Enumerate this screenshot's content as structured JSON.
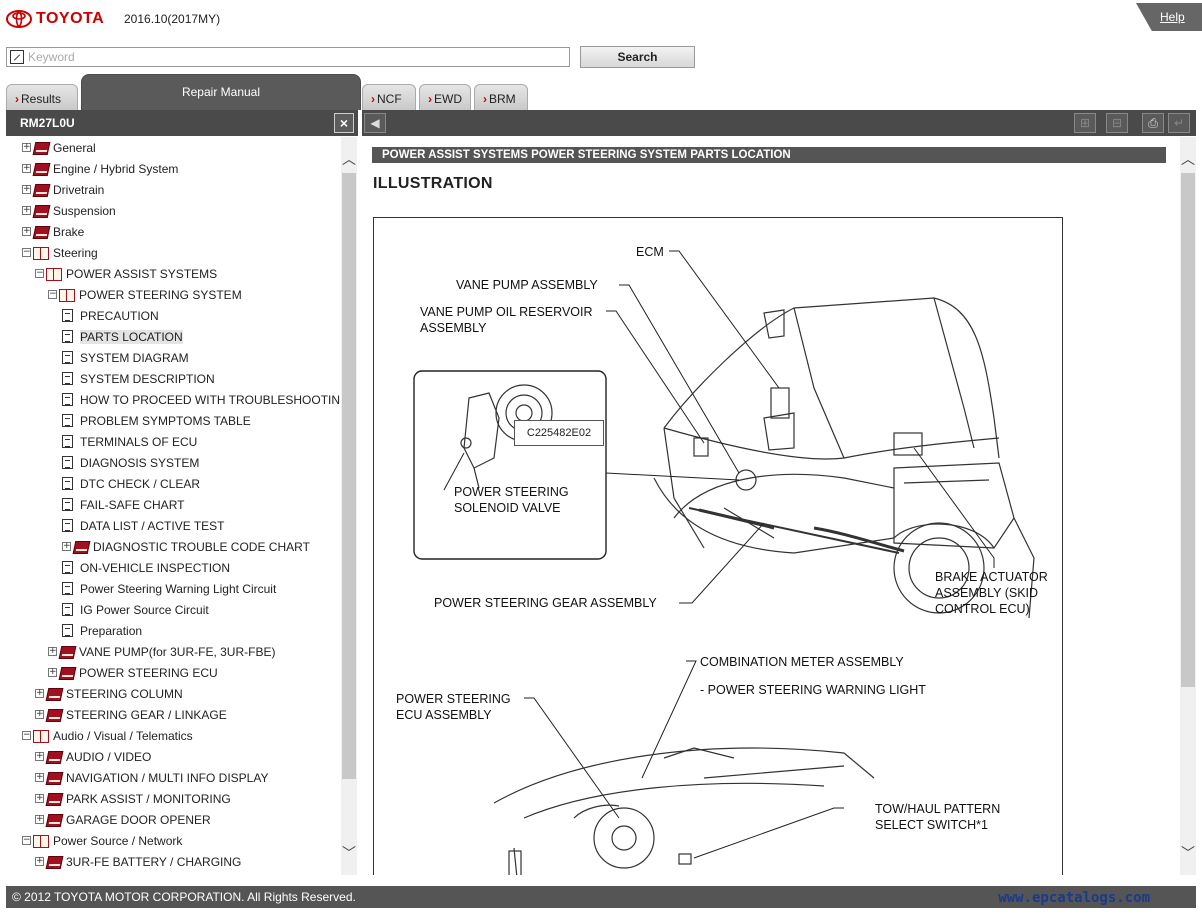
{
  "header": {
    "brand": "TOYOTA",
    "version": "2016.10(2017MY)",
    "help_label": "Help"
  },
  "search": {
    "placeholder": "Keyword",
    "button_label": "Search"
  },
  "tabs": [
    {
      "label": "Results",
      "active": false
    },
    {
      "label": "Repair Manual",
      "active": true
    },
    {
      "label": "NCF",
      "active": false
    },
    {
      "label": "EWD",
      "active": false
    },
    {
      "label": "BRM",
      "active": false
    }
  ],
  "left_panel": {
    "title": "RM27L0U",
    "close_label": "×",
    "tree": [
      {
        "label": "General",
        "level": 0,
        "type": "closed",
        "expand": "+"
      },
      {
        "label": "Engine / Hybrid System",
        "level": 0,
        "type": "closed",
        "expand": "+"
      },
      {
        "label": "Drivetrain",
        "level": 0,
        "type": "closed",
        "expand": "+"
      },
      {
        "label": "Suspension",
        "level": 0,
        "type": "closed",
        "expand": "+"
      },
      {
        "label": "Brake",
        "level": 0,
        "type": "closed",
        "expand": "+"
      },
      {
        "label": "Steering",
        "level": 0,
        "type": "open",
        "expand": "−"
      },
      {
        "label": "POWER ASSIST SYSTEMS",
        "level": 1,
        "type": "open",
        "expand": "−"
      },
      {
        "label": "POWER STEERING SYSTEM",
        "level": 2,
        "type": "open",
        "expand": "−"
      },
      {
        "label": "PRECAUTION",
        "level": 3,
        "type": "doc"
      },
      {
        "label": "PARTS LOCATION",
        "level": 3,
        "type": "doc",
        "selected": true
      },
      {
        "label": "SYSTEM DIAGRAM",
        "level": 3,
        "type": "doc"
      },
      {
        "label": "SYSTEM DESCRIPTION",
        "level": 3,
        "type": "doc"
      },
      {
        "label": "HOW TO PROCEED WITH TROUBLESHOOTING",
        "level": 3,
        "type": "doc"
      },
      {
        "label": "PROBLEM SYMPTOMS TABLE",
        "level": 3,
        "type": "doc"
      },
      {
        "label": "TERMINALS OF ECU",
        "level": 3,
        "type": "doc"
      },
      {
        "label": "DIAGNOSIS SYSTEM",
        "level": 3,
        "type": "doc"
      },
      {
        "label": "DTC CHECK / CLEAR",
        "level": 3,
        "type": "doc"
      },
      {
        "label": "FAIL-SAFE CHART",
        "level": 3,
        "type": "doc"
      },
      {
        "label": "DATA LIST / ACTIVE TEST",
        "level": 3,
        "type": "doc"
      },
      {
        "label": "DIAGNOSTIC TROUBLE CODE CHART",
        "level": 3,
        "type": "closed",
        "expand": "+"
      },
      {
        "label": "ON-VEHICLE INSPECTION",
        "level": 3,
        "type": "doc"
      },
      {
        "label": "Power Steering Warning Light Circuit",
        "level": 3,
        "type": "doc"
      },
      {
        "label": "IG Power Source Circuit",
        "level": 3,
        "type": "doc"
      },
      {
        "label": "Preparation",
        "level": 3,
        "type": "doc"
      },
      {
        "label": "VANE PUMP(for 3UR-FE, 3UR-FBE)",
        "level": 2,
        "type": "closed",
        "expand": "+"
      },
      {
        "label": "POWER STEERING ECU",
        "level": 2,
        "type": "closed",
        "expand": "+"
      },
      {
        "label": "STEERING COLUMN",
        "level": 1,
        "type": "closed",
        "expand": "+"
      },
      {
        "label": "STEERING GEAR / LINKAGE",
        "level": 1,
        "type": "closed",
        "expand": "+"
      },
      {
        "label": "Audio / Visual / Telematics",
        "level": 0,
        "type": "open",
        "expand": "−"
      },
      {
        "label": "AUDIO / VIDEO",
        "level": 1,
        "type": "closed",
        "expand": "+"
      },
      {
        "label": "NAVIGATION / MULTI INFO DISPLAY",
        "level": 1,
        "type": "closed",
        "expand": "+"
      },
      {
        "label": "PARK ASSIST / MONITORING",
        "level": 1,
        "type": "closed",
        "expand": "+"
      },
      {
        "label": "GARAGE DOOR OPENER",
        "level": 1,
        "type": "closed",
        "expand": "+"
      },
      {
        "label": "Power Source / Network",
        "level": 0,
        "type": "open",
        "expand": "−"
      },
      {
        "label": "3UR-FE BATTERY / CHARGING",
        "level": 1,
        "type": "closed",
        "expand": "+"
      }
    ]
  },
  "content": {
    "breadcrumb": "POWER ASSIST SYSTEMS  POWER STEERING SYSTEM  PARTS LOCATION",
    "section_title": "ILLUSTRATION",
    "illustration": {
      "inset_code": "C225482E02",
      "labels": {
        "ecm": "ECM",
        "vane_pump": "VANE PUMP ASSEMBLY",
        "reservoir_1": "VANE PUMP OIL RESERVOIR",
        "reservoir_2": "ASSEMBLY",
        "solenoid_1": "POWER STEERING",
        "solenoid_2": "SOLENOID VALVE",
        "gear": "POWER STEERING GEAR ASSEMBLY",
        "brake_1": "BRAKE ACTUATOR",
        "brake_2": "ASSEMBLY (SKID",
        "brake_3": "CONTROL ECU)",
        "meter": "COMBINATION METER ASSEMBLY",
        "warning_light": "- POWER STEERING WARNING LIGHT",
        "ps_ecu_1": "POWER STEERING",
        "ps_ecu_2": "ECU ASSEMBLY",
        "towhaul_1": "TOW/HAUL PATTERN",
        "towhaul_2": "SELECT SWITCH*1"
      }
    }
  },
  "footer": {
    "copyright": "© 2012 TOYOTA MOTOR CORPORATION. All Rights Reserved.",
    "watermark": "www.epcatalogs.com"
  },
  "colors": {
    "brand_red": "#cc0000",
    "header_gray": "#4a4a4a",
    "tab_active": "#5a5a5a"
  }
}
